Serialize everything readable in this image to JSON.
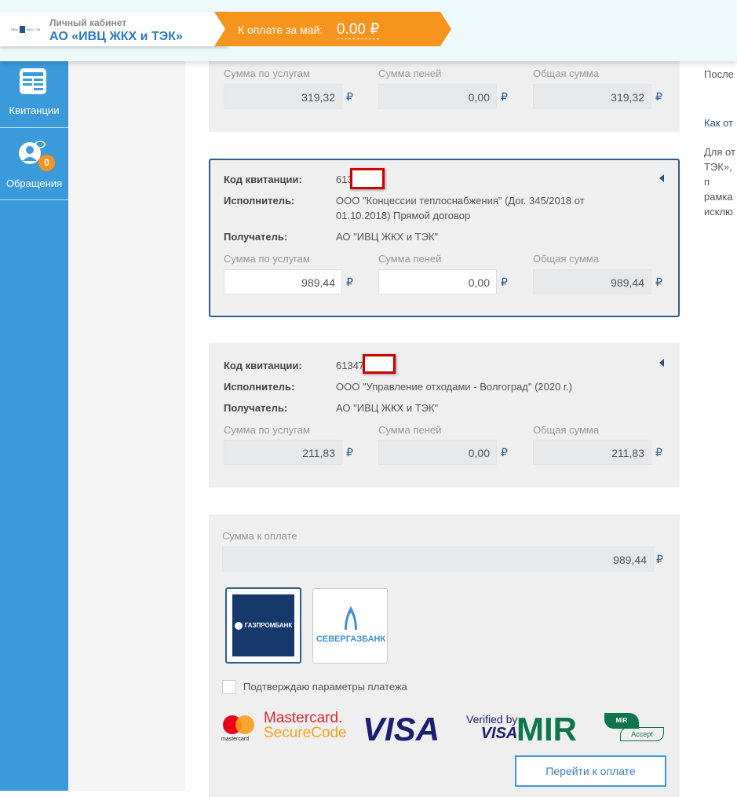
{
  "header": {
    "cabinet_label": "Личный кабинет",
    "org_name": "АО «ИВЦ ЖКХ и ТЭК»",
    "logo_text": "ИВЦ ЖКХ и ТЭК",
    "due_label": "К оплате за май:",
    "due_amount": "0.00 ₽"
  },
  "sidebar": {
    "items": [
      {
        "label": "Квитанции",
        "icon": "receipt-icon"
      },
      {
        "label": "Обращения",
        "icon": "user-chat-icon",
        "badge": "0"
      }
    ]
  },
  "labels": {
    "code": "Код квитанции:",
    "executor": "Исполнитель:",
    "recipient": "Получатель:",
    "services": "Сумма по услугам",
    "penalty": "Сумма пеней",
    "total": "Общая сумма",
    "currency": "₽"
  },
  "receipts": [
    {
      "services": "319,32",
      "penalty": "0,00",
      "total": "319,32"
    },
    {
      "code": "613",
      "executor": "ООО \"Концессии теплоснабжения\" (Дог. 345/2018 от 01.10.2018) Прямой договор",
      "recipient": "АО \"ИВЦ ЖКХ и ТЭК\"",
      "services": "989,44",
      "penalty": "0,00",
      "total": "989,44"
    },
    {
      "code": "61347",
      "executor": "ООО \"Управление отходами - Волгоград\" (2020 г.)",
      "recipient": "АО \"ИВЦ ЖКХ и ТЭК\"",
      "services": "211,83",
      "penalty": "0,00",
      "total": "211,83"
    }
  ],
  "payment": {
    "sum_label": "Сумма к оплате",
    "sum": "989,44",
    "banks": [
      "ГАЗПРОМБАНК",
      "СЕВЕРГАЗБАНК"
    ],
    "confirm_label": "Подтверждаю параметры платежа",
    "submit": "Перейти к оплате",
    "logos": {
      "mc": "mastercard",
      "mc1": "Mastercard.",
      "mc2": "SecureCode",
      "visa": "VISA",
      "vbv1": "Verified by",
      "vbv2": "VISA",
      "mir": "MIR",
      "mira": "MIR",
      "accept": "Accept"
    }
  },
  "right_panel": {
    "lines": [
      "После",
      "Как от",
      "Для от",
      "ТЭК», п",
      "рамка",
      "исклю"
    ]
  }
}
